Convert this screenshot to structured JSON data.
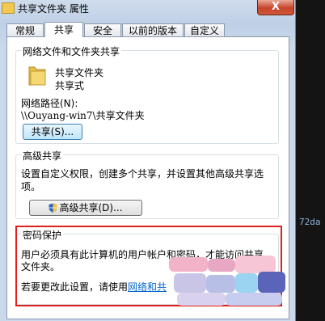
{
  "window": {
    "title": "共享文件夹 属性",
    "close_label": "X"
  },
  "tabs": [
    {
      "label": "常规",
      "active": false
    },
    {
      "label": "共享",
      "active": true
    },
    {
      "label": "安全",
      "active": false
    },
    {
      "label": "以前的版本",
      "active": false
    },
    {
      "label": "自定义",
      "active": false
    }
  ],
  "network_share": {
    "group_title": "网络文件和文件夹共享",
    "folder_name": "共享文件夹",
    "share_state": "共享式",
    "path_label": "网络路径(N):",
    "path_value": "\\\\Ouyang-win7\\共享文件夹",
    "share_button": "共享(S)..."
  },
  "advanced_share": {
    "group_title": "高级共享",
    "description_line1": "设置自定义权限，创建多个共享，并设置其他高级共享选",
    "description_line2": "项。",
    "button_label": "高级共享(D)..."
  },
  "password_protection": {
    "group_title": "密码保护",
    "line1": "用户必须具有此计算机的用户帐户和密码，才能访问共享",
    "line2": "文件夹。",
    "change_prefix": "若要更改此设置，请使用",
    "link_text": "网络和共"
  },
  "background": {
    "peek_text": "72da"
  },
  "colors": {
    "highlight_border": "#e0201c",
    "link": "#0066cc",
    "accent": "#3c7fb1"
  }
}
